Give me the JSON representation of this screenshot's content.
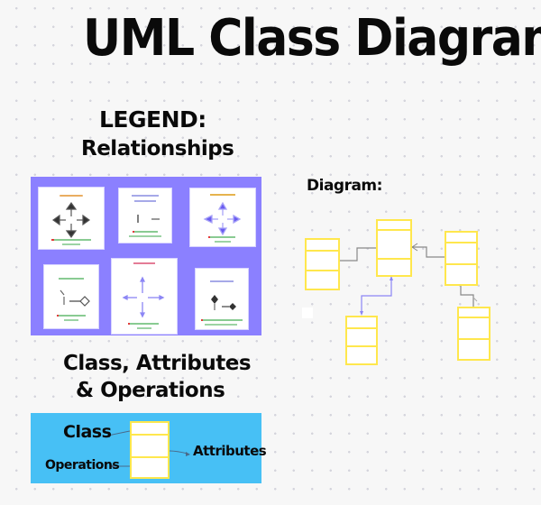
{
  "title": "UML Class Diagram",
  "legend": {
    "heading": "LEGEND:",
    "subheading": "Relationships",
    "panel_color": "#8b80ff",
    "cards": [
      {
        "icon": "association-arrows-icon",
        "caption_color": "#e08a1e",
        "glyph_color": "#333333"
      },
      {
        "icon": "dependency-lines-icon",
        "caption_color": "#6a6fd8",
        "glyph_color": "#555555"
      },
      {
        "icon": "inheritance-arrows-icon",
        "caption_color": "#e0a020",
        "glyph_color": "#6a5cf0"
      },
      {
        "icon": "aggregation-diamond-icon",
        "caption_color": "#3aa84a",
        "glyph_color": "#555555"
      },
      {
        "icon": "realization-arrows-icon",
        "caption_color": "#d9446a",
        "glyph_color": "#7b73e8"
      },
      {
        "icon": "composition-diamond-icon",
        "caption_color": "#6a6fd8",
        "glyph_color": "#333333"
      }
    ],
    "note_colors": {
      "marker": "#e23b3b",
      "text": "#3aa84a"
    }
  },
  "diagram": {
    "heading": "Diagram:",
    "box_color": "#ffe74d",
    "connector_color": "#888888",
    "dependency_color": "#8c86f5"
  },
  "cao": {
    "heading_line1": "Class, Attributes",
    "heading_line2": "& Operations",
    "panel_color": "#47c0f5",
    "labels": {
      "class": "Class",
      "attributes": "Attributes",
      "operations": "Operations"
    }
  }
}
